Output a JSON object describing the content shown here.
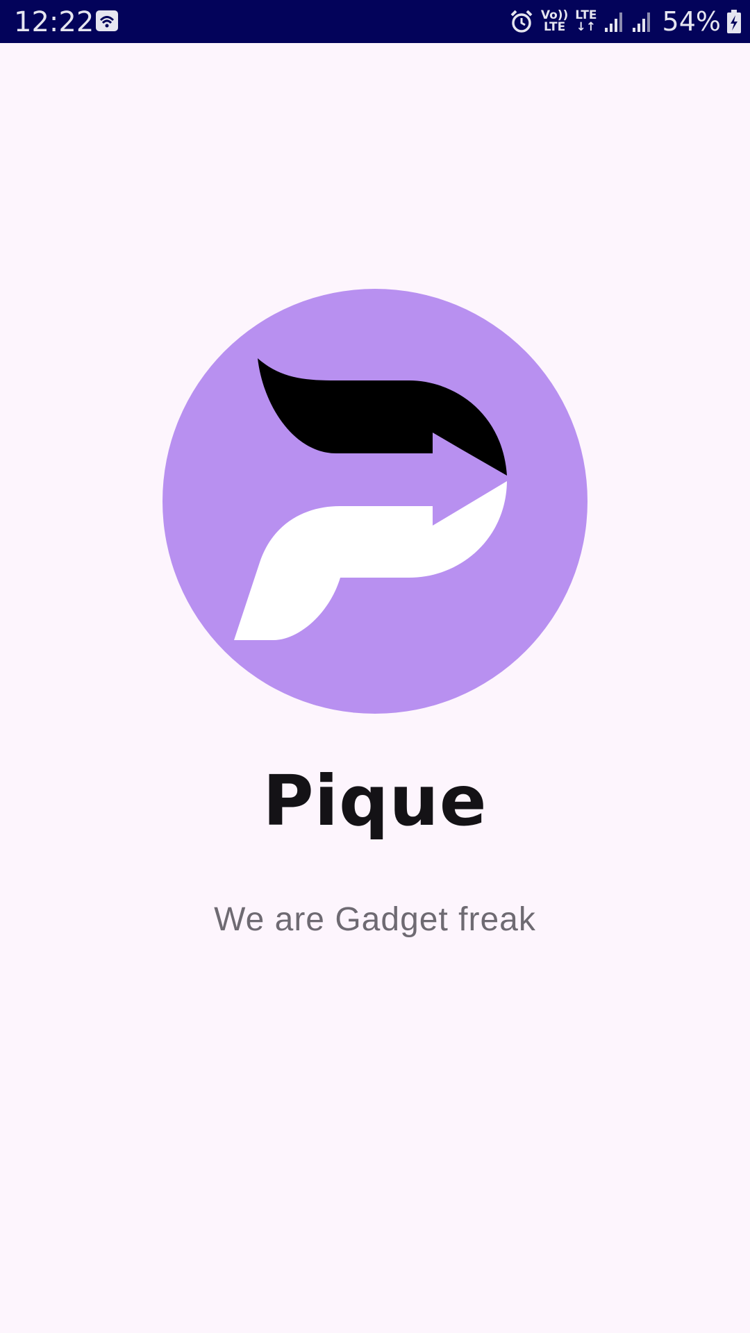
{
  "status_bar": {
    "time": "12:22",
    "volte_top": "Vo))",
    "volte_bottom": "LTE",
    "lte_top": "LTE",
    "lte_bottom": "↓↑",
    "battery": "54%",
    "left_icon": "gallery-notification-icon",
    "icons": [
      "alarm-icon",
      "volte-icon",
      "lte-data-icon",
      "signal-icon",
      "signal-icon",
      "battery-charging-icon"
    ]
  },
  "splash": {
    "title": "Pique",
    "tagline": "We are Gadget freak",
    "logo_icon": "pique-logo-icon"
  },
  "colors": {
    "status_bar_bg": "#03035A",
    "background": "#FDF5FD",
    "logo_circle": "#B890F0",
    "title": "#141216",
    "tagline": "#6E6A72"
  }
}
